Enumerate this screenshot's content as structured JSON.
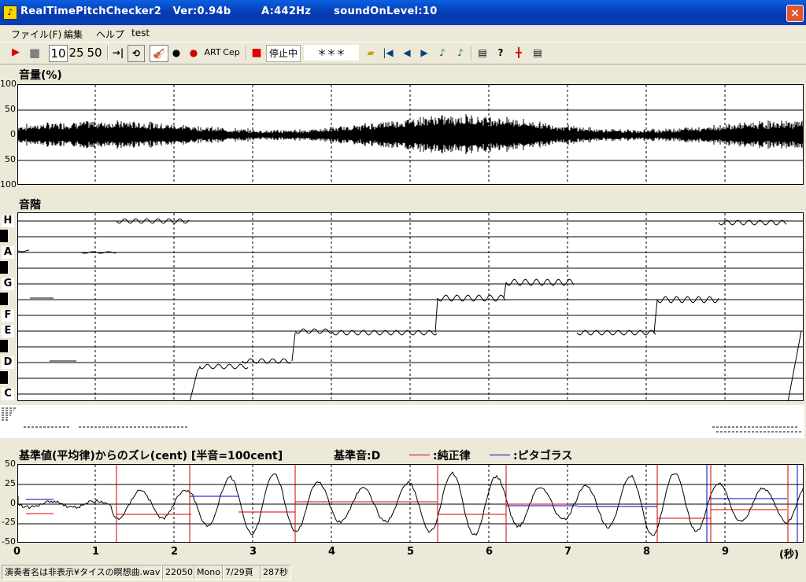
{
  "window": {
    "title": "RealTimePitchChecker2   Ver:0.94b        A:442Hz      soundOnLevel:10",
    "icon": "tuning-fork-icon",
    "close": "×"
  },
  "menu": [
    "ファイル(F)",
    "編集",
    "ヘルプ",
    "test"
  ],
  "toolbar": {
    "play": "▶",
    "stop": "■",
    "n10": "10",
    "n25": "25",
    "n50": "50",
    "art": "ART",
    "cep": "Cep",
    "status": "停止中",
    "display": "＊＊＊"
  },
  "volume": {
    "title": "音量(%)",
    "ticks": [
      "100",
      "50",
      "0",
      "50",
      "100"
    ]
  },
  "scale": {
    "title": "音階",
    "notes": [
      "H",
      "A",
      "G",
      "F",
      "E",
      "D",
      "C"
    ]
  },
  "deviation": {
    "title": "基準値(平均律)からのズレ(cent) [半音=100cent]",
    "base": "基準音:D",
    "just_label": ":純正律",
    "pyth_label": ":ピタゴラス",
    "ticks": [
      "50",
      "25",
      "0",
      "-25",
      "-50"
    ],
    "colors": {
      "just": "#d00000",
      "pyth": "#0000c0"
    }
  },
  "time_axis": {
    "labels": [
      "0",
      "1",
      "2",
      "3",
      "4",
      "5",
      "6",
      "7",
      "8",
      "9"
    ],
    "unit": "(秒)"
  },
  "statusbar": {
    "file": "演奏者名は非表示¥タイスの瞑想曲.wav",
    "rate": "22050",
    "channel": "Mono",
    "page": "7/29頁",
    "length": "287秒"
  }
}
